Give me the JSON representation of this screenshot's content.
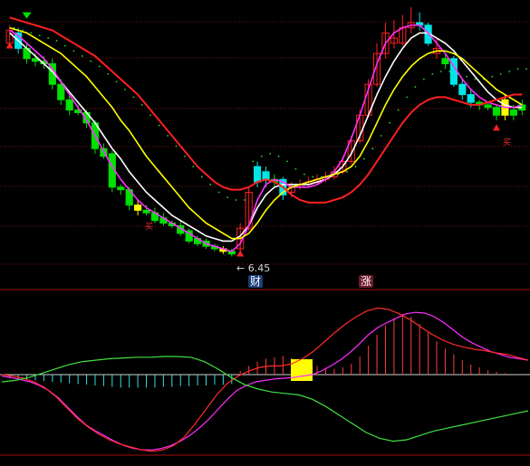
{
  "price_label": "← 6.45",
  "badges": {
    "left": "财",
    "right": "涨"
  },
  "markers_text": {
    "a": "买",
    "b": "买"
  },
  "colors": {
    "background": "#000000",
    "up": "#ff2020",
    "down_green": "#00e000",
    "down_cyan": "#00e5e5",
    "ma_white": "#ffffff",
    "ma_magenta": "#ff30ff",
    "ma_yellow": "#ffff00",
    "ma_red": "#ff1a1a",
    "dots": "#30d030",
    "grid": "#7a1212"
  },
  "icons": [
    "triangle-down-green",
    "triangle-up-red",
    "arrow-left"
  ],
  "chart_data": [
    {
      "type": "candlestick",
      "title": "",
      "price_marker": 6.45,
      "candles": [
        {
          "o": 0.86,
          "c": 0.91,
          "h": 0.93,
          "l": 0.84,
          "col": "red"
        },
        {
          "o": 0.9,
          "c": 0.84,
          "h": 0.92,
          "l": 0.82,
          "col": "cyan"
        },
        {
          "o": 0.84,
          "c": 0.8,
          "h": 0.86,
          "l": 0.78,
          "col": "green"
        },
        {
          "o": 0.8,
          "c": 0.79,
          "h": 0.82,
          "l": 0.77,
          "col": "green"
        },
        {
          "o": 0.79,
          "c": 0.78,
          "h": 0.81,
          "l": 0.76,
          "col": "green"
        },
        {
          "o": 0.78,
          "c": 0.7,
          "h": 0.8,
          "l": 0.68,
          "col": "green"
        },
        {
          "o": 0.7,
          "c": 0.64,
          "h": 0.72,
          "l": 0.62,
          "col": "green"
        },
        {
          "o": 0.64,
          "c": 0.6,
          "h": 0.66,
          "l": 0.58,
          "col": "green"
        },
        {
          "o": 0.6,
          "c": 0.59,
          "h": 0.62,
          "l": 0.58,
          "col": "green"
        },
        {
          "o": 0.59,
          "c": 0.55,
          "h": 0.6,
          "l": 0.53,
          "col": "green"
        },
        {
          "o": 0.55,
          "c": 0.45,
          "h": 0.56,
          "l": 0.43,
          "col": "green"
        },
        {
          "o": 0.45,
          "c": 0.42,
          "h": 0.47,
          "l": 0.41,
          "col": "green"
        },
        {
          "o": 0.43,
          "c": 0.3,
          "h": 0.44,
          "l": 0.28,
          "col": "green"
        },
        {
          "o": 0.3,
          "c": 0.29,
          "h": 0.31,
          "l": 0.27,
          "col": "green"
        },
        {
          "o": 0.29,
          "c": 0.23,
          "h": 0.3,
          "l": 0.21,
          "col": "green"
        },
        {
          "o": 0.23,
          "c": 0.21,
          "h": 0.25,
          "l": 0.19,
          "col": "yellow"
        },
        {
          "o": 0.21,
          "c": 0.2,
          "h": 0.23,
          "l": 0.19,
          "col": "green"
        },
        {
          "o": 0.2,
          "c": 0.17,
          "h": 0.22,
          "l": 0.16,
          "col": "green"
        },
        {
          "o": 0.18,
          "c": 0.16,
          "h": 0.2,
          "l": 0.15,
          "col": "green"
        },
        {
          "o": 0.16,
          "c": 0.15,
          "h": 0.17,
          "l": 0.14,
          "col": "green"
        },
        {
          "o": 0.15,
          "c": 0.12,
          "h": 0.17,
          "l": 0.11,
          "col": "green"
        },
        {
          "o": 0.13,
          "c": 0.09,
          "h": 0.14,
          "l": 0.08,
          "col": "green"
        },
        {
          "o": 0.1,
          "c": 0.08,
          "h": 0.11,
          "l": 0.07,
          "col": "green"
        },
        {
          "o": 0.09,
          "c": 0.07,
          "h": 0.1,
          "l": 0.06,
          "col": "green"
        },
        {
          "o": 0.07,
          "c": 0.06,
          "h": 0.08,
          "l": 0.05,
          "col": "green"
        },
        {
          "o": 0.06,
          "c": 0.05,
          "h": 0.07,
          "l": 0.04,
          "col": "yellow"
        },
        {
          "o": 0.05,
          "c": 0.04,
          "h": 0.06,
          "l": 0.03,
          "col": "green"
        },
        {
          "o": 0.06,
          "c": 0.14,
          "h": 0.16,
          "l": 0.05,
          "col": "red"
        },
        {
          "o": 0.14,
          "c": 0.28,
          "h": 0.3,
          "l": 0.13,
          "col": "red"
        },
        {
          "o": 0.38,
          "c": 0.32,
          "h": 0.4,
          "l": 0.3,
          "col": "cyan"
        },
        {
          "o": 0.36,
          "c": 0.33,
          "h": 0.38,
          "l": 0.3,
          "col": "cyan"
        },
        {
          "o": 0.33,
          "c": 0.32,
          "h": 0.35,
          "l": 0.3,
          "col": "green"
        },
        {
          "o": 0.33,
          "c": 0.27,
          "h": 0.34,
          "l": 0.25,
          "col": "cyan"
        },
        {
          "o": 0.28,
          "c": 0.3,
          "h": 0.32,
          "l": 0.26,
          "col": "red"
        },
        {
          "o": 0.3,
          "c": 0.31,
          "h": 0.33,
          "l": 0.29,
          "col": "red"
        },
        {
          "o": 0.31,
          "c": 0.32,
          "h": 0.34,
          "l": 0.3,
          "col": "red"
        },
        {
          "o": 0.32,
          "c": 0.33,
          "h": 0.35,
          "l": 0.31,
          "col": "red"
        },
        {
          "o": 0.33,
          "c": 0.34,
          "h": 0.36,
          "l": 0.32,
          "col": "red"
        },
        {
          "o": 0.34,
          "c": 0.36,
          "h": 0.38,
          "l": 0.33,
          "col": "red"
        },
        {
          "o": 0.36,
          "c": 0.4,
          "h": 0.42,
          "l": 0.35,
          "col": "red"
        },
        {
          "o": 0.4,
          "c": 0.48,
          "h": 0.5,
          "l": 0.39,
          "col": "red"
        },
        {
          "o": 0.48,
          "c": 0.58,
          "h": 0.6,
          "l": 0.47,
          "col": "red"
        },
        {
          "o": 0.58,
          "c": 0.7,
          "h": 0.72,
          "l": 0.57,
          "col": "red"
        },
        {
          "o": 0.7,
          "c": 0.82,
          "h": 0.86,
          "l": 0.69,
          "col": "red"
        },
        {
          "o": 0.82,
          "c": 0.9,
          "h": 0.94,
          "l": 0.8,
          "col": "red"
        },
        {
          "o": 0.88,
          "c": 0.86,
          "h": 0.95,
          "l": 0.84,
          "col": "red"
        },
        {
          "o": 0.86,
          "c": 0.92,
          "h": 0.97,
          "l": 0.85,
          "col": "red"
        },
        {
          "o": 0.92,
          "c": 0.94,
          "h": 1.0,
          "l": 0.9,
          "col": "red"
        },
        {
          "o": 0.94,
          "c": 0.93,
          "h": 0.98,
          "l": 0.91,
          "col": "cyan"
        },
        {
          "o": 0.93,
          "c": 0.86,
          "h": 0.94,
          "l": 0.85,
          "col": "cyan"
        },
        {
          "o": 0.84,
          "c": 0.82,
          "h": 0.88,
          "l": 0.8,
          "col": "red"
        },
        {
          "o": 0.8,
          "c": 0.78,
          "h": 0.82,
          "l": 0.76,
          "col": "green"
        },
        {
          "o": 0.8,
          "c": 0.7,
          "h": 0.81,
          "l": 0.69,
          "col": "cyan"
        },
        {
          "o": 0.7,
          "c": 0.66,
          "h": 0.72,
          "l": 0.64,
          "col": "cyan"
        },
        {
          "o": 0.66,
          "c": 0.63,
          "h": 0.68,
          "l": 0.61,
          "col": "cyan"
        },
        {
          "o": 0.63,
          "c": 0.62,
          "h": 0.64,
          "l": 0.6,
          "col": "green"
        },
        {
          "o": 0.62,
          "c": 0.61,
          "h": 0.63,
          "l": 0.6,
          "col": "green"
        },
        {
          "o": 0.61,
          "c": 0.58,
          "h": 0.62,
          "l": 0.56,
          "col": "green"
        },
        {
          "o": 0.58,
          "c": 0.64,
          "h": 0.66,
          "l": 0.56,
          "col": "yellow"
        },
        {
          "o": 0.6,
          "c": 0.58,
          "h": 0.62,
          "l": 0.56,
          "col": "green"
        },
        {
          "o": 0.6,
          "c": 0.62,
          "h": 0.64,
          "l": 0.58,
          "col": "green"
        }
      ],
      "series": [
        {
          "color": "white",
          "values": [
            0.9,
            0.87,
            0.84,
            0.81,
            0.78,
            0.75,
            0.71,
            0.67,
            0.63,
            0.59,
            0.55,
            0.5,
            0.45,
            0.41,
            0.36,
            0.32,
            0.28,
            0.25,
            0.22,
            0.19,
            0.17,
            0.15,
            0.13,
            0.11,
            0.1,
            0.09,
            0.09,
            0.11,
            0.15,
            0.22,
            0.27,
            0.3,
            0.31,
            0.31,
            0.31,
            0.31,
            0.32,
            0.33,
            0.35,
            0.38,
            0.43,
            0.5,
            0.58,
            0.66,
            0.73,
            0.79,
            0.84,
            0.88,
            0.9,
            0.9,
            0.88,
            0.86,
            0.83,
            0.79,
            0.75,
            0.71,
            0.67,
            0.64,
            0.62,
            0.61,
            0.61
          ]
        },
        {
          "color": "magenta",
          "values": [
            0.91,
            0.89,
            0.86,
            0.83,
            0.8,
            0.76,
            0.71,
            0.66,
            0.61,
            0.56,
            0.5,
            0.44,
            0.38,
            0.33,
            0.29,
            0.25,
            0.22,
            0.2,
            0.18,
            0.16,
            0.14,
            0.12,
            0.1,
            0.08,
            0.07,
            0.06,
            0.05,
            0.08,
            0.15,
            0.25,
            0.31,
            0.33,
            0.32,
            0.3,
            0.3,
            0.3,
            0.31,
            0.33,
            0.36,
            0.41,
            0.49,
            0.58,
            0.68,
            0.78,
            0.86,
            0.9,
            0.92,
            0.93,
            0.93,
            0.9,
            0.86,
            0.82,
            0.77,
            0.72,
            0.68,
            0.65,
            0.63,
            0.62,
            0.61,
            0.61,
            0.62
          ]
        },
        {
          "color": "yellow",
          "values": [
            0.92,
            0.91,
            0.9,
            0.88,
            0.86,
            0.84,
            0.82,
            0.79,
            0.76,
            0.73,
            0.69,
            0.65,
            0.61,
            0.56,
            0.52,
            0.47,
            0.42,
            0.38,
            0.34,
            0.3,
            0.26,
            0.22,
            0.19,
            0.16,
            0.14,
            0.12,
            0.1,
            0.1,
            0.12,
            0.16,
            0.21,
            0.25,
            0.28,
            0.3,
            0.31,
            0.32,
            0.33,
            0.34,
            0.35,
            0.36,
            0.38,
            0.42,
            0.48,
            0.55,
            0.62,
            0.68,
            0.73,
            0.77,
            0.8,
            0.82,
            0.83,
            0.83,
            0.82,
            0.8,
            0.77,
            0.74,
            0.71,
            0.68,
            0.66,
            0.64,
            0.62
          ]
        },
        {
          "color": "red",
          "values": [
            0.96,
            0.95,
            0.94,
            0.93,
            0.92,
            0.91,
            0.89,
            0.87,
            0.85,
            0.83,
            0.81,
            0.78,
            0.75,
            0.72,
            0.69,
            0.66,
            0.62,
            0.58,
            0.54,
            0.5,
            0.46,
            0.42,
            0.38,
            0.35,
            0.32,
            0.3,
            0.29,
            0.29,
            0.3,
            0.32,
            0.33,
            0.32,
            0.3,
            0.27,
            0.25,
            0.24,
            0.24,
            0.24,
            0.25,
            0.26,
            0.28,
            0.31,
            0.35,
            0.4,
            0.45,
            0.5,
            0.55,
            0.59,
            0.62,
            0.64,
            0.65,
            0.65,
            0.64,
            0.63,
            0.62,
            0.62,
            0.63,
            0.64,
            0.65,
            0.66,
            0.66
          ]
        }
      ]
    },
    {
      "type": "macd",
      "title": "",
      "hist": [
        -0.05,
        -0.06,
        -0.07,
        -0.08,
        -0.09,
        -0.1,
        -0.11,
        -0.12,
        -0.13,
        -0.14,
        -0.15,
        -0.16,
        -0.17,
        -0.18,
        -0.18,
        -0.18,
        -0.18,
        -0.18,
        -0.17,
        -0.17,
        -0.16,
        -0.16,
        -0.15,
        -0.15,
        -0.14,
        -0.14,
        -0.13,
        0.05,
        0.12,
        0.18,
        0.22,
        0.24,
        0.26,
        0.23,
        0.2,
        0.16,
        0.12,
        0.09,
        0.08,
        0.1,
        0.15,
        0.25,
        0.4,
        0.55,
        0.68,
        0.78,
        0.84,
        0.8,
        0.7,
        0.58,
        0.46,
        0.36,
        0.28,
        0.2,
        0.14,
        0.1,
        0.06,
        0.04,
        0.02,
        0.01,
        0.0
      ],
      "series": [
        {
          "color": "magenta",
          "values": [
            -0.02,
            -0.04,
            -0.07,
            -0.1,
            -0.15,
            -0.22,
            -0.32,
            -0.45,
            -0.58,
            -0.7,
            -0.78,
            -0.85,
            -0.92,
            -0.98,
            -1.02,
            -1.04,
            -1.04,
            -1.02,
            -0.98,
            -0.92,
            -0.84,
            -0.74,
            -0.62,
            -0.48,
            -0.34,
            -0.22,
            -0.15,
            -0.1,
            -0.08,
            -0.06,
            -0.05,
            -0.04,
            -0.02,
            0.0,
            0.05,
            0.12,
            0.2,
            0.3,
            0.42,
            0.55,
            0.65,
            0.72,
            0.78,
            0.84,
            0.86,
            0.85,
            0.8,
            0.72,
            0.62,
            0.52,
            0.44,
            0.38,
            0.32,
            0.28,
            0.24,
            0.22,
            0.2
          ]
        },
        {
          "color": "red",
          "values": [
            0.0,
            -0.02,
            -0.05,
            -0.1,
            -0.18,
            -0.3,
            -0.45,
            -0.6,
            -0.72,
            -0.82,
            -0.9,
            -0.96,
            -1.0,
            -1.04,
            -1.06,
            -1.04,
            -0.98,
            -0.86,
            -0.68,
            -0.48,
            -0.28,
            -0.12,
            -0.02,
            0.05,
            0.1,
            0.12,
            0.12,
            0.15,
            0.22,
            0.32,
            0.45,
            0.58,
            0.7,
            0.8,
            0.88,
            0.92,
            0.9,
            0.84,
            0.76,
            0.66,
            0.56,
            0.48,
            0.42,
            0.38,
            0.35,
            0.33,
            0.3,
            0.28,
            0.24,
            0.2
          ]
        },
        {
          "color": "green",
          "values": [
            -0.1,
            -0.08,
            -0.04,
            0.02,
            0.08,
            0.14,
            0.18,
            0.2,
            0.22,
            0.23,
            0.24,
            0.24,
            0.25,
            0.25,
            0.24,
            0.18,
            0.08,
            -0.04,
            -0.14,
            -0.2,
            -0.24,
            -0.26,
            -0.28,
            -0.34,
            -0.44,
            -0.56,
            -0.68,
            -0.8,
            -0.88,
            -0.92,
            -0.9,
            -0.84,
            -0.78,
            -0.74,
            -0.7,
            -0.66,
            -0.62,
            -0.58,
            -0.54,
            -0.5
          ]
        },
        {
          "color": "white",
          "values": [
            0,
            0,
            0,
            0,
            0,
            0,
            0,
            0,
            0,
            0
          ]
        }
      ]
    }
  ]
}
